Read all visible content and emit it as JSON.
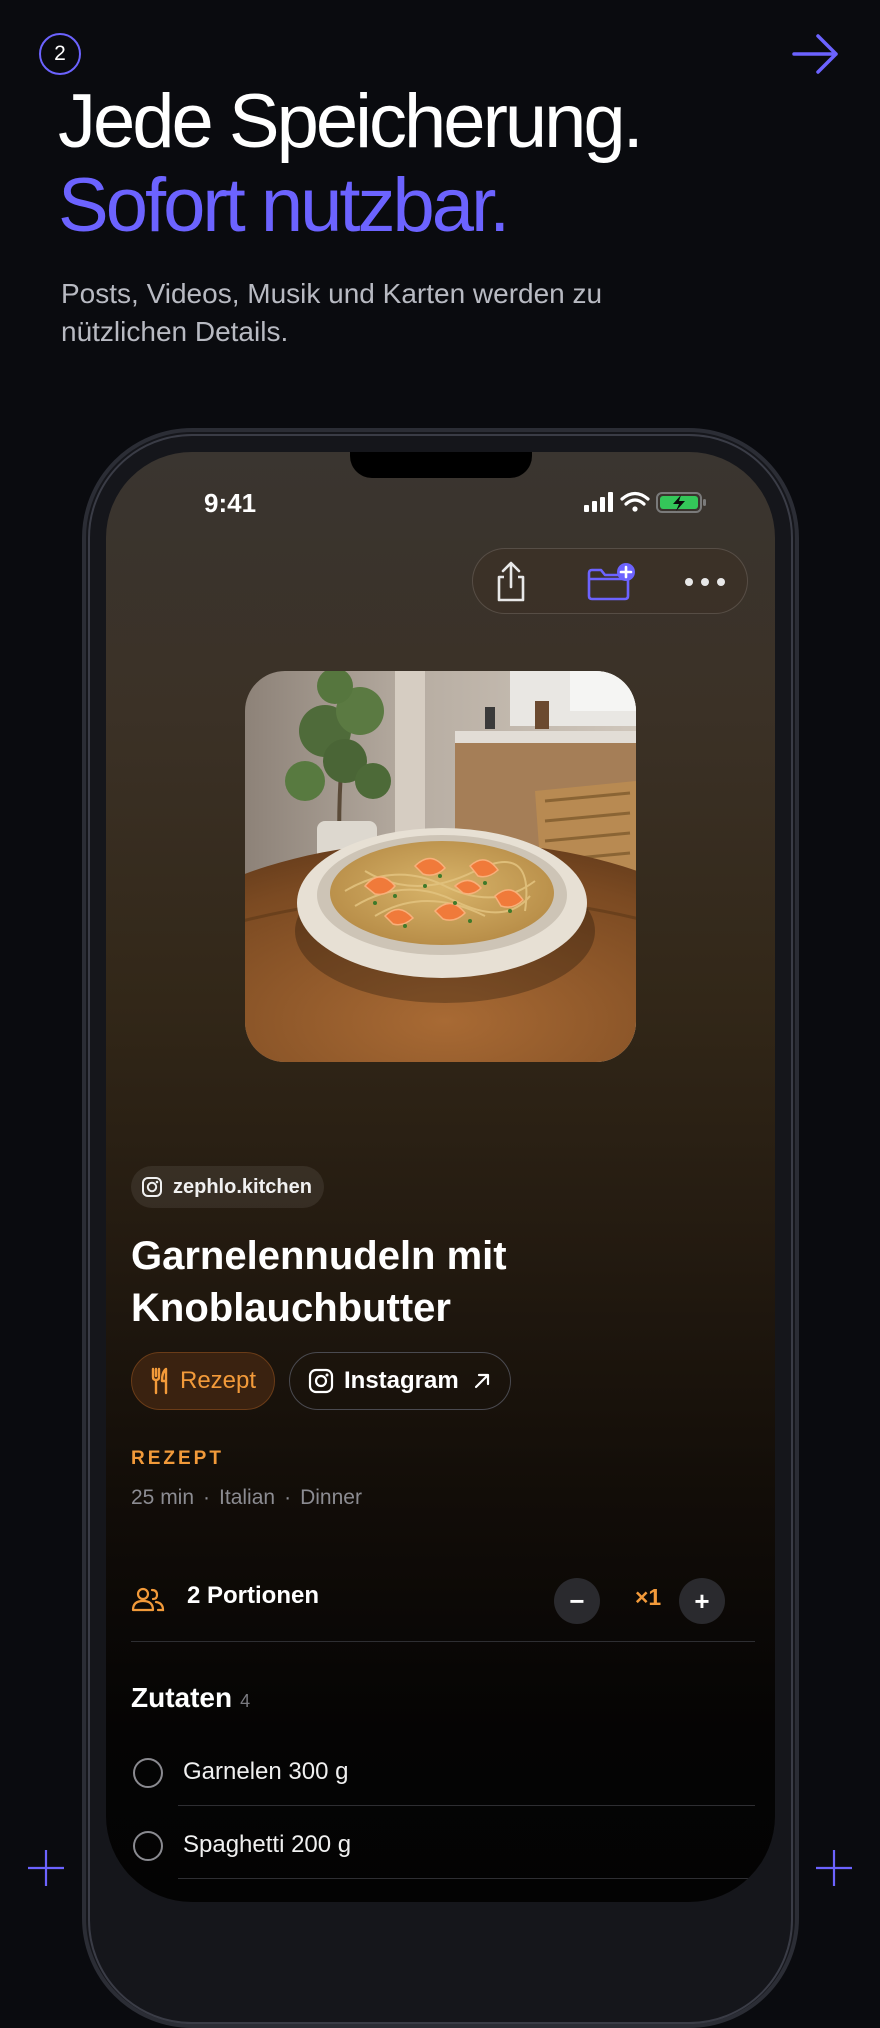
{
  "header": {
    "step_number": "2",
    "headline_line1": "Jede Speicherung.",
    "headline_line2": "Sofort nutzbar.",
    "subtitle": "Posts, Videos, Musik und Karten werden zu nützlichen Details."
  },
  "colors": {
    "accent": "#6c63ff",
    "recipe_orange": "#f29a3a",
    "background": "#0a0b0f"
  },
  "phone": {
    "status_time": "9:41",
    "toolbar": {
      "icons": [
        "share-icon",
        "folder-add-icon",
        "more-icon"
      ]
    },
    "source_handle": "zephlo.kitchen",
    "recipe_title_line1": "Garnelennudeln mit",
    "recipe_title_line2": "Knoblauchbutter",
    "tags": {
      "recipe_label": "Rezept",
      "instagram_label": "Instagram"
    },
    "section_label": "REZEPT",
    "meta": {
      "time": "25 min",
      "cuisine": "Italian",
      "meal": "Dinner",
      "separator": "·"
    },
    "portions": {
      "label": "2 Portionen",
      "multiplier": "×1",
      "minus": "−",
      "plus": "+"
    },
    "ingredients": {
      "heading": "Zutaten",
      "count": "4",
      "items": [
        "Garnelen 300 g",
        "Spaghetti 200 g"
      ]
    }
  }
}
